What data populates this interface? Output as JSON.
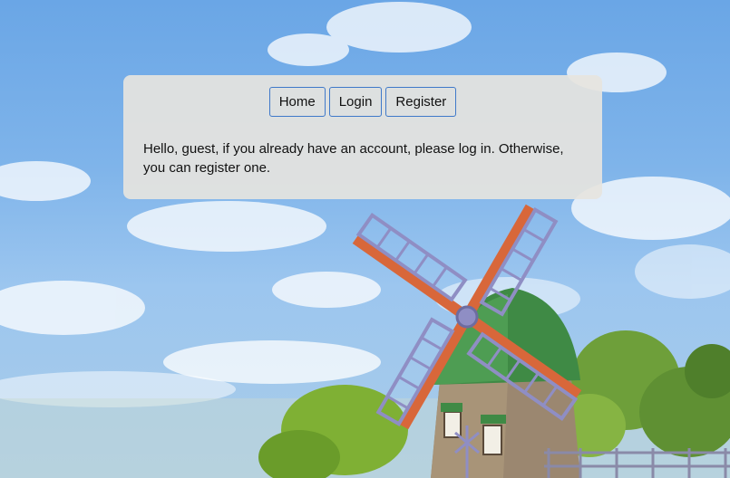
{
  "nav": {
    "items": [
      {
        "label": "Home"
      },
      {
        "label": "Login"
      },
      {
        "label": "Register"
      }
    ]
  },
  "message": "Hello, guest, if you already have an account, please log in. Otherwise, you can register one.",
  "colors": {
    "sky": "#7fb4ea",
    "panel": "#e6e4de",
    "button_border": "#3f79c9"
  },
  "background": {
    "subject": "windmill-landscape"
  }
}
